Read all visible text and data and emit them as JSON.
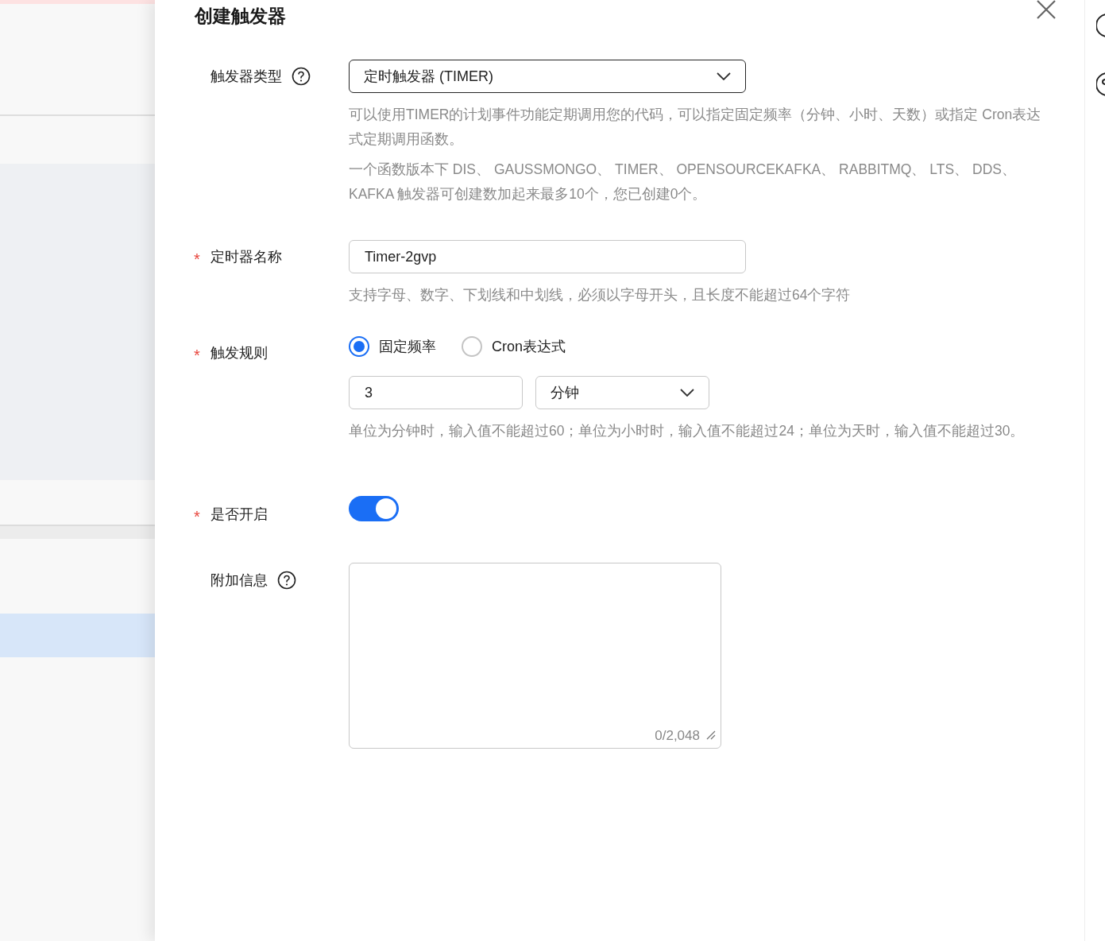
{
  "title": "创建触发器",
  "fields": [
    {
      "kind": "select",
      "label": "触发器类型",
      "help": true,
      "value": "定时触发器 (TIMER)",
      "hints": [
        "可以使用TIMER的计划事件功能定期调用您的代码，可以指定固定频率（分钟、小时、天数）或指定 Cron表达式定期调用函数。",
        "一个函数版本下 DIS、 GAUSSMONGO、 TIMER、 OPENSOURCEKAFKA、 RABBITMQ、 LTS、 DDS、 KAFKA 触发器可创建数加起来最多10个，您已创建0个。"
      ]
    },
    {
      "kind": "text",
      "label": "定时器名称",
      "required_mark": "*",
      "value": "Timer-2gvp",
      "hints": [
        "支持字母、数字、下划线和中划线，必须以字母开头，且长度不能超过64个字符"
      ]
    },
    {
      "kind": "rule",
      "label": "触发规则",
      "required_mark": "*",
      "options": [
        {
          "label": "固定频率",
          "selected": true
        },
        {
          "label": "Cron表达式",
          "selected": false
        }
      ],
      "number": "3",
      "unit": "分钟",
      "hints": [
        "单位为分钟时，输入值不能超过60；单位为小时时，输入值不能超过24；单位为天时，输入值不能超过30。"
      ]
    },
    {
      "kind": "switch",
      "label": "是否开启",
      "required_mark": "*",
      "on": true
    },
    {
      "kind": "textarea",
      "label": "附加信息",
      "help": true,
      "counter": "0/2,048"
    }
  ]
}
